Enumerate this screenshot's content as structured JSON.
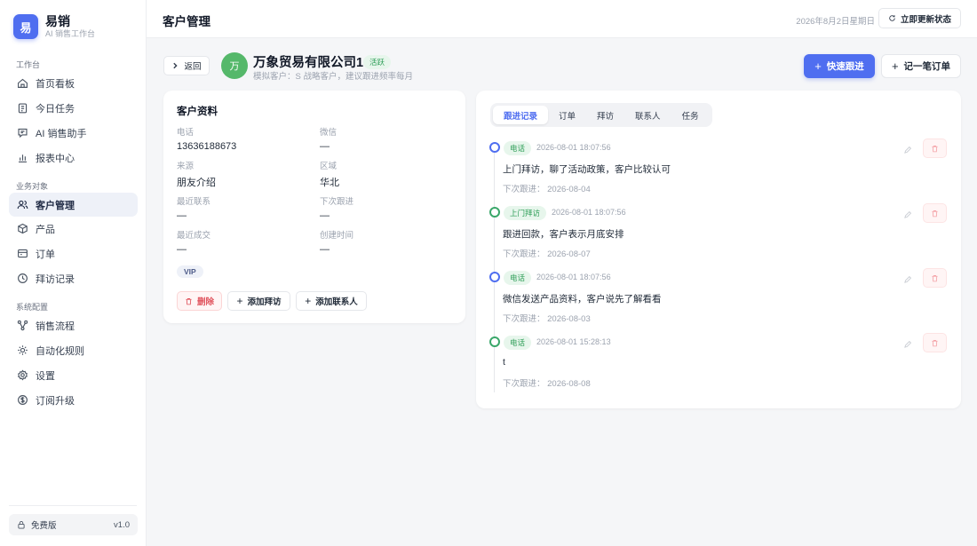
{
  "brand": {
    "logo_char": "易",
    "name": "易销",
    "subtitle": "AI 销售工作台"
  },
  "sidebar": {
    "sections": [
      {
        "title": "工作台",
        "items": [
          {
            "label": "首页看板",
            "icon": "dashboard-icon"
          },
          {
            "label": "今日任务",
            "icon": "clipboard-icon"
          },
          {
            "label": "AI 销售助手",
            "icon": "chat-icon"
          },
          {
            "label": "报表中心",
            "icon": "bar-chart-icon"
          }
        ]
      },
      {
        "title": "业务对象",
        "items": [
          {
            "label": "客户管理",
            "icon": "users-icon",
            "active": true
          },
          {
            "label": "产品",
            "icon": "box-icon"
          },
          {
            "label": "订单",
            "icon": "receipt-icon"
          },
          {
            "label": "拜访记录",
            "icon": "clock-icon"
          }
        ]
      },
      {
        "title": "系统配置",
        "items": [
          {
            "label": "销售流程",
            "icon": "flow-icon"
          },
          {
            "label": "自动化规则",
            "icon": "sun-icon"
          },
          {
            "label": "设置",
            "icon": "gear-icon"
          },
          {
            "label": "订阅升级",
            "icon": "dollar-icon"
          }
        ]
      }
    ],
    "plan": {
      "label": "免费版",
      "version": "v1.0"
    }
  },
  "header": {
    "title": "客户管理",
    "date": "2026年8月2日星期日",
    "refresh_label": "立即更新状态"
  },
  "customer": {
    "back_label": "返回",
    "avatar_char": "万",
    "name": "万象贸易有限公司1",
    "status": "活跃",
    "description": "模拟客户：S 战略客户，建议跟进频率每月",
    "quick_followup_label": "快速跟进",
    "record_order_label": "记一笔订单"
  },
  "profile": {
    "title": "客户资料",
    "fields": {
      "phone": {
        "label": "电话",
        "value": "13636188673"
      },
      "wechat": {
        "label": "微信",
        "value": "—"
      },
      "source": {
        "label": "来源",
        "value": "朋友介绍"
      },
      "region": {
        "label": "区域",
        "value": "华北"
      },
      "last_contact": {
        "label": "最近联系",
        "value": "—"
      },
      "next_followup": {
        "label": "下次跟进",
        "value": "—"
      },
      "last_deal": {
        "label": "最近成交",
        "value": "—"
      },
      "created_at": {
        "label": "创建时间",
        "value": "—"
      }
    },
    "tag": "VIP",
    "actions": {
      "delete": "删除",
      "add_visit": "添加拜访",
      "add_contact": "添加联系人"
    }
  },
  "timeline": {
    "tabs": [
      "跟进记录",
      "订单",
      "拜访",
      "联系人",
      "任务"
    ],
    "active_tab": 0,
    "items": [
      {
        "type": "电话",
        "time": "2026-08-01 18:07:56",
        "content": "上门拜访，聊了活动政策，客户比较认可",
        "next": "下次跟进：  2026-08-04",
        "dot": "blue"
      },
      {
        "type": "上门拜访",
        "time": "2026-08-01 18:07:56",
        "content": "跟进回款，客户表示月底安排",
        "next": "下次跟进：  2026-08-07",
        "dot": "green"
      },
      {
        "type": "电话",
        "time": "2026-08-01 18:07:56",
        "content": "微信发送产品资料，客户说先了解看看",
        "next": "下次跟进：  2026-08-03",
        "dot": "blue"
      },
      {
        "type": "电话",
        "time": "2026-08-01 15:28:13",
        "content": "t",
        "next": "下次跟进：  2026-08-08",
        "dot": "green"
      }
    ]
  },
  "colors": {
    "accent": "#4f6ef0",
    "success": "#2f9e58",
    "danger": "#e0525c"
  }
}
